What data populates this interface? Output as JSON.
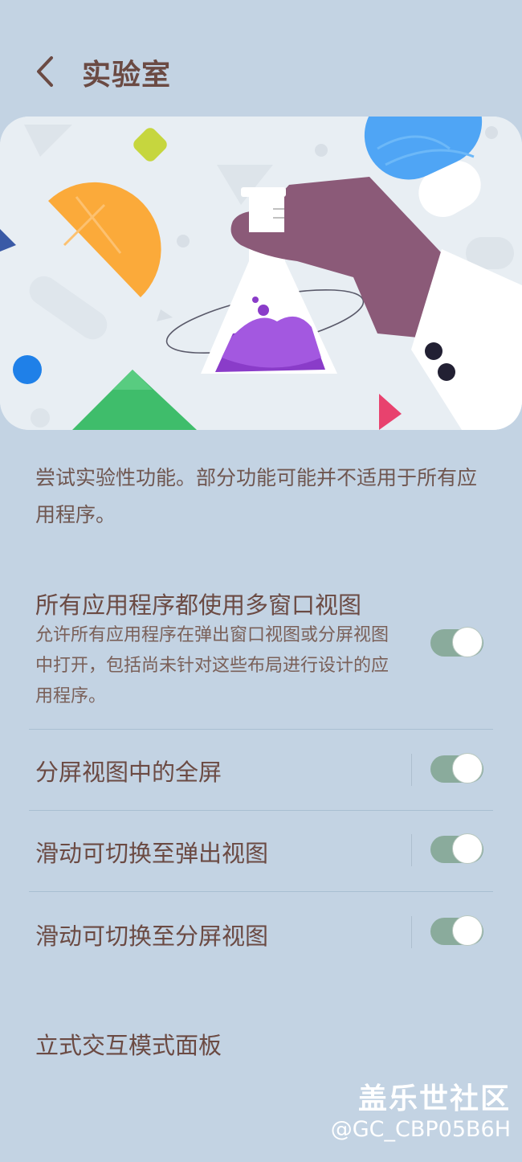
{
  "header": {
    "title": "实验室",
    "back_icon": "chevron-left-icon"
  },
  "intro": {
    "text": "尝试实验性功能。部分功能可能并不适用于所有应用程序。"
  },
  "settings": [
    {
      "title": "所有应用程序都使用多窗口视图",
      "subtitle": "允许所有应用程序在弹出窗口视图或分屏视图中打开，包括尚未针对这些布局进行设计的应用程序。",
      "enabled": true
    },
    {
      "title": "分屏视图中的全屏",
      "enabled": true
    },
    {
      "title": "滑动可切换至弹出视图",
      "enabled": true
    },
    {
      "title": "滑动可切换至分屏视图",
      "enabled": true
    },
    {
      "title": "立式交互模式面板"
    }
  ],
  "watermark": {
    "line1": "盖乐世社区",
    "line2": "@GC_CBP05B6H"
  },
  "colors": {
    "background": "#c3d3e3",
    "toggle_on": "#8aab9c",
    "text": "#6b4a43"
  }
}
